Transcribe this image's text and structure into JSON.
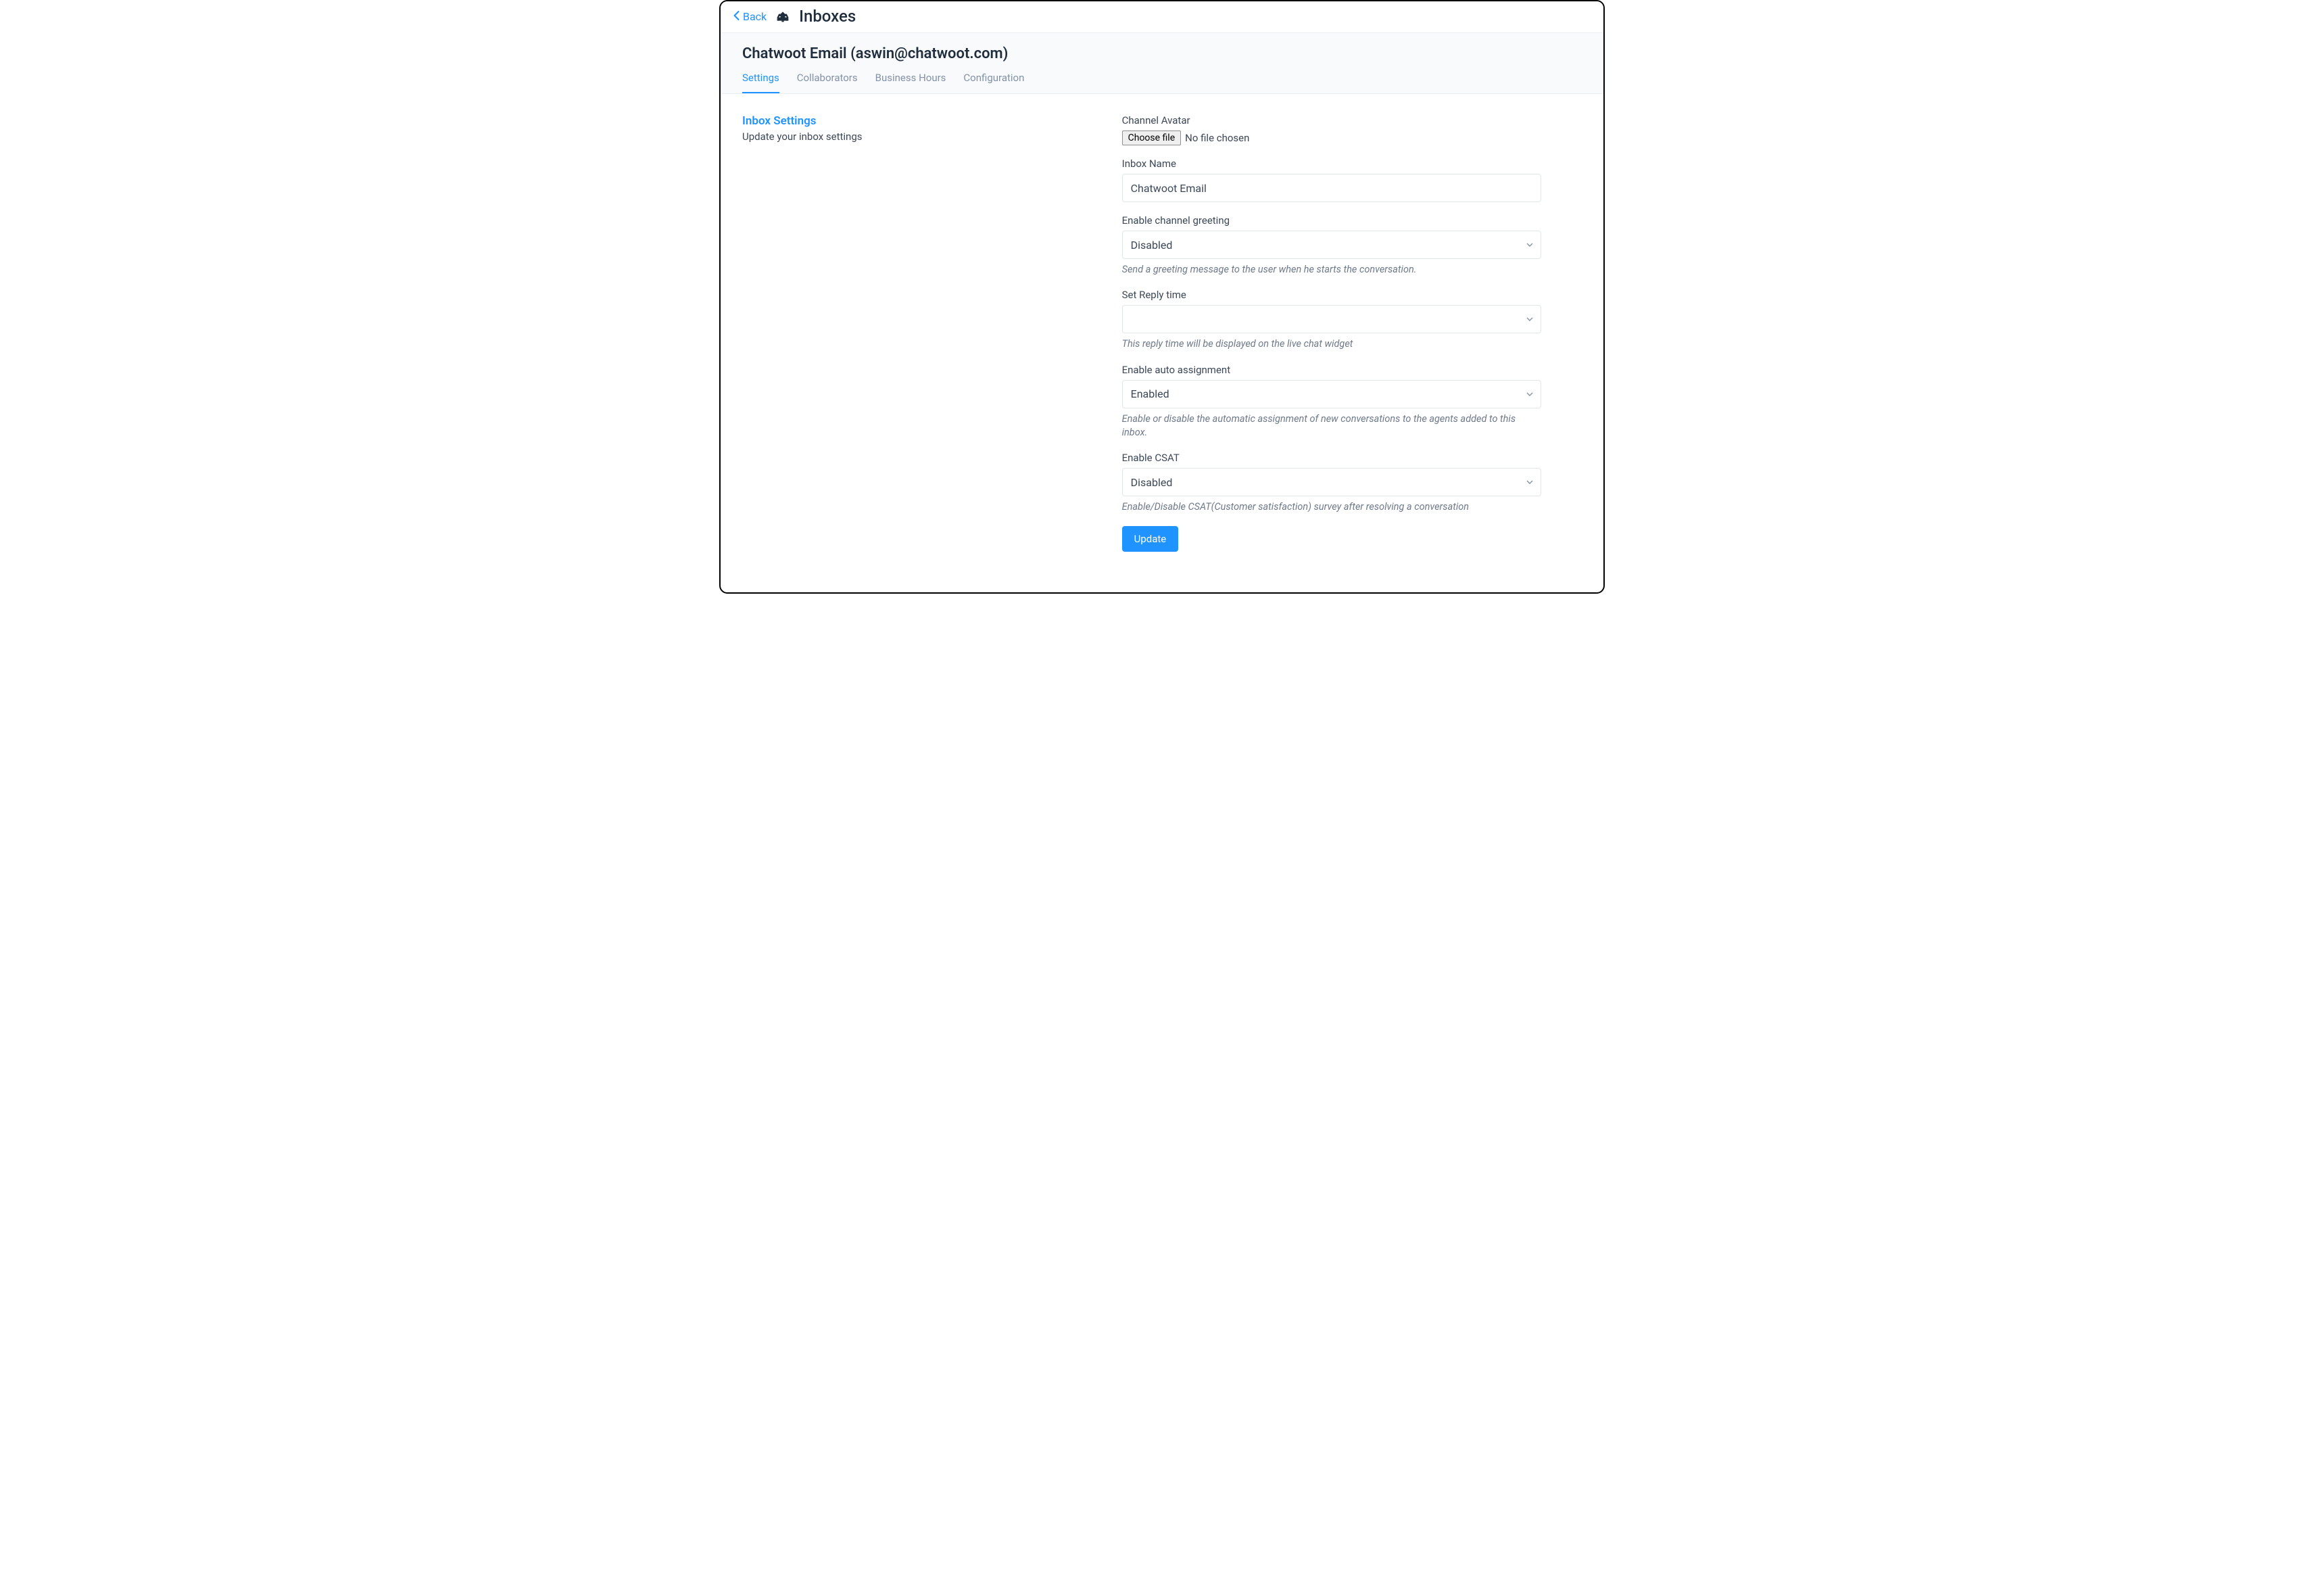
{
  "header": {
    "back_label": "Back",
    "title": "Inboxes"
  },
  "subheader": {
    "title": "Chatwoot Email (aswin@chatwoot.com)",
    "tabs": [
      {
        "label": "Settings"
      },
      {
        "label": "Collaborators"
      },
      {
        "label": "Business Hours"
      },
      {
        "label": "Configuration"
      }
    ]
  },
  "sidebar": {
    "heading": "Inbox Settings",
    "subheading": "Update your inbox settings"
  },
  "form": {
    "avatar": {
      "label": "Channel Avatar",
      "button": "Choose file",
      "status": "No file chosen"
    },
    "inbox_name": {
      "label": "Inbox Name",
      "value": "Chatwoot Email"
    },
    "greeting": {
      "label": "Enable channel greeting",
      "value": "Disabled",
      "hint": "Send a greeting message to the user when he starts the conversation."
    },
    "reply_time": {
      "label": "Set Reply time",
      "value": "",
      "hint": "This reply time will be displayed on the live chat widget"
    },
    "auto_assign": {
      "label": "Enable auto assignment",
      "value": "Enabled",
      "hint": "Enable or disable the automatic assignment of new conversations to the agents added to this inbox."
    },
    "csat": {
      "label": "Enable CSAT",
      "value": "Disabled",
      "hint": "Enable/Disable CSAT(Customer satisfaction) survey after resolving a conversation"
    },
    "submit_label": "Update"
  }
}
